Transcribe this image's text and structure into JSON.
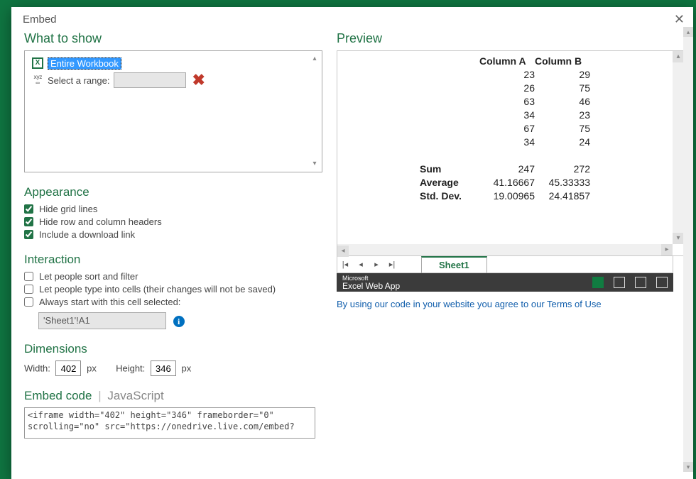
{
  "dialog": {
    "title": "Embed",
    "section_what": "What to show",
    "workbook_label": "Entire Workbook",
    "range_label": "Select a range:",
    "range_value": "",
    "section_appearance": "Appearance",
    "chk_gridlines": "Hide grid lines",
    "chk_headers": "Hide row and column headers",
    "chk_download": "Include a download link",
    "section_interaction": "Interaction",
    "chk_sort": "Let people sort and filter",
    "chk_type": "Let people type into cells (their changes will not be saved)",
    "chk_startcell": "Always start with this cell selected:",
    "start_cell_value": "'Sheet1'!A1",
    "section_dimensions": "Dimensions",
    "width_label": "Width:",
    "width_value": "402",
    "height_label": "Height:",
    "height_value": "346",
    "px": "px",
    "section_embed": "Embed code",
    "tab_js": "JavaScript",
    "embed_code": "<iframe width=\"402\" height=\"346\" frameborder=\"0\" scrolling=\"no\" src=\"https://onedrive.live.com/embed?"
  },
  "preview": {
    "title": "Preview",
    "sheet_name": "Sheet1",
    "brand_small": "Microsoft",
    "brand": "Excel Web App",
    "agree_text": "By using our code in your website you agree to our Terms of Use"
  },
  "chart_data": {
    "type": "table",
    "columns": [
      "Column A",
      "Column B"
    ],
    "rows": [
      [
        23,
        29
      ],
      [
        26,
        75
      ],
      [
        63,
        46
      ],
      [
        34,
        23
      ],
      [
        67,
        75
      ],
      [
        34,
        24
      ]
    ],
    "summary": [
      {
        "label": "Sum",
        "a": "247",
        "b": "272"
      },
      {
        "label": "Average",
        "a": "41.16667",
        "b": "45.33333"
      },
      {
        "label": "Std. Dev.",
        "a": "19.00965",
        "b": "24.41857"
      }
    ]
  }
}
